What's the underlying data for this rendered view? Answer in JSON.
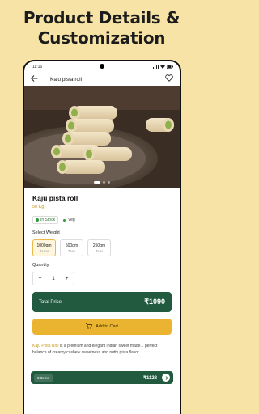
{
  "headline": {
    "line1": "Product Details &",
    "line2": "Customization"
  },
  "status_bar": {
    "time": "11:16",
    "icons": [
      "signal-icon",
      "wifi-icon",
      "battery-icon"
    ]
  },
  "app_bar": {
    "title": "Kaju pista roll",
    "back_icon": "arrow-left-icon",
    "wishlist_icon": "heart-outline-icon"
  },
  "carousel": {
    "dots": 3,
    "active_index": 0
  },
  "product": {
    "name": "Kaju pista roll",
    "weight": "50 Kg",
    "stock_badge": "In Stock",
    "veg_label": "Veg"
  },
  "weights": {
    "label": "Select Weight",
    "options": [
      {
        "weight": "1000gm",
        "price": "₹1090",
        "selected": true
      },
      {
        "weight": "500gm",
        "price": "₹555",
        "selected": false
      },
      {
        "weight": "250gm",
        "price": "₹280",
        "selected": false
      }
    ]
  },
  "quantity": {
    "label": "Quantity",
    "minus": "−",
    "value": "1",
    "plus": "+"
  },
  "total": {
    "label": "Total Price",
    "value": "₹1090"
  },
  "add_to_cart": {
    "label": "Add to Cart",
    "icon": "cart-icon"
  },
  "description": {
    "highlight": "Kaju Pista Roll",
    "text": " is a premium and elegant Indian sweet made... perfect balance of creamy cashew sweetness and nutty pista flavor."
  },
  "cart_bar": {
    "items": "3 Items",
    "total": "₹1128",
    "go_icon": "arrow-right-icon"
  },
  "colors": {
    "background": "#f7e3a6",
    "primary_green": "#215a3e",
    "accent_gold": "#eab430"
  }
}
